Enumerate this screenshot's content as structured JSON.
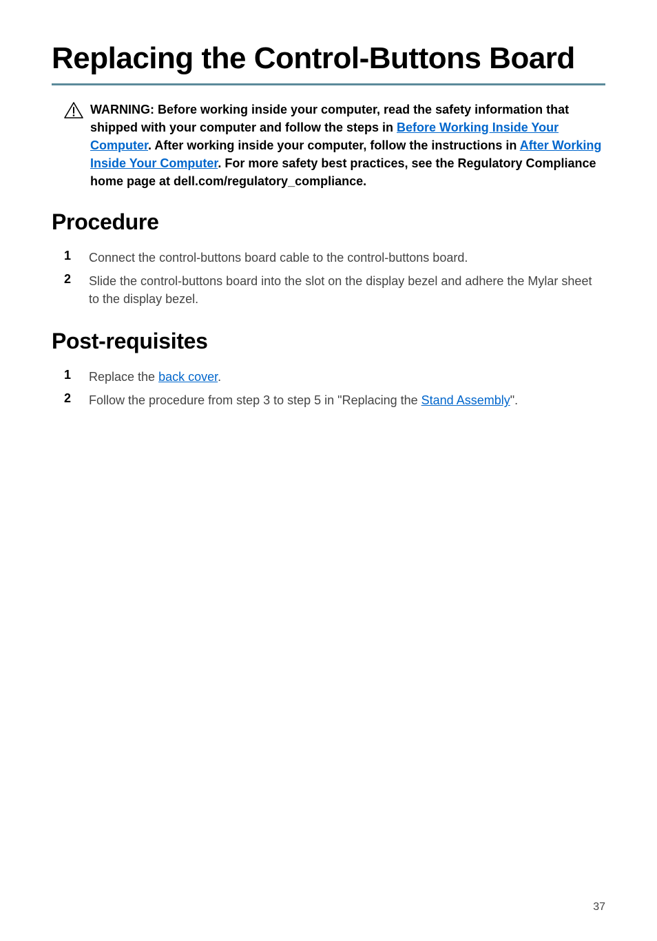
{
  "title": "Replacing the Control-Buttons Board",
  "warning": {
    "prefix": "WARNING: Before working inside your computer, read the safety information that shipped with your computer and follow the steps in ",
    "link1": "Before Working Inside Your Computer",
    "mid1": ". After working inside your computer, follow the instructions in ",
    "link2": "After Working Inside Your Computer",
    "suffix": ". For more safety best practices, see the Regulatory Compliance home page at dell.com/regulatory_compliance."
  },
  "sections": {
    "procedure": {
      "heading": "Procedure",
      "items": [
        {
          "num": "1",
          "text": "Connect the control-buttons board cable to the control-buttons board."
        },
        {
          "num": "2",
          "text": "Slide the control-buttons board into the slot on the display bezel and adhere the Mylar sheet to the display bezel."
        }
      ]
    },
    "postreq": {
      "heading": "Post-requisites",
      "items": [
        {
          "num": "1",
          "pre": "Replace the ",
          "link": "back cover",
          "post": "."
        },
        {
          "num": "2",
          "pre": "Follow the procedure from step 3 to step 5 in \"Replacing the ",
          "link": "Stand Assembly",
          "post": "\"."
        }
      ]
    }
  },
  "page_number": "37"
}
